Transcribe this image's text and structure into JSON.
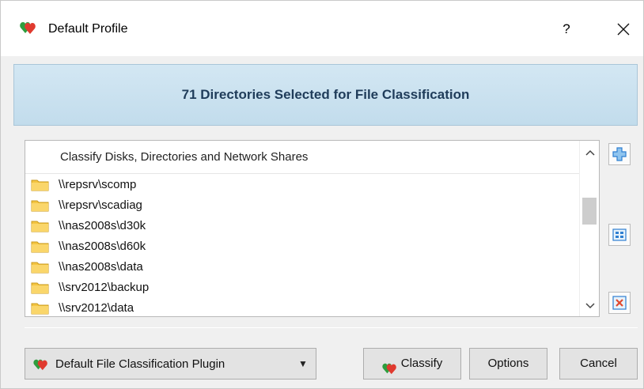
{
  "window": {
    "title": "Default Profile",
    "help_label": "?",
    "app_icon": "profile-hearts-icon"
  },
  "banner": {
    "text": "71 Directories Selected for File Classification",
    "color": "#1f3c5a"
  },
  "list": {
    "header": "Classify Disks, Directories and Network Shares",
    "items": [
      {
        "label": "\\\\repsrv\\scomp",
        "icon": "folder-icon"
      },
      {
        "label": "\\\\repsrv\\scadiag",
        "icon": "folder-icon"
      },
      {
        "label": "\\\\nas2008s\\d30k",
        "icon": "folder-icon"
      },
      {
        "label": "\\\\nas2008s\\d60k",
        "icon": "folder-icon"
      },
      {
        "label": "\\\\nas2008s\\data",
        "icon": "folder-icon"
      },
      {
        "label": "\\\\srv2012\\backup",
        "icon": "folder-icon"
      },
      {
        "label": "\\\\srv2012\\data",
        "icon": "folder-icon"
      }
    ]
  },
  "side_buttons": {
    "add": "add-directory-icon",
    "edit": "edit-list-icon",
    "remove": "remove-directory-icon"
  },
  "footer": {
    "plugin_selected": "Default File Classification Plugin",
    "classify_label": "Classify",
    "options_label": "Options",
    "cancel_label": "Cancel"
  },
  "colors": {
    "banner_bg": "#c9e1f0",
    "accent_blue": "#2f7fd1",
    "folder": "#f4c542"
  }
}
